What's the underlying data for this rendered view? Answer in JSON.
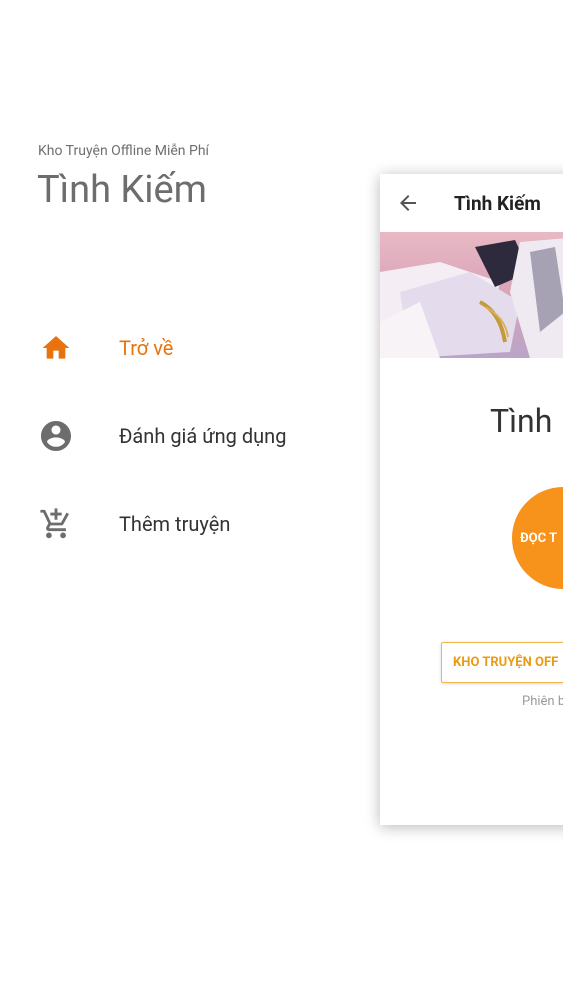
{
  "drawer": {
    "subtitle": "Kho Truyện Offline Miễn Phí",
    "title": "Tình Kiếm",
    "items": [
      {
        "label": "Trở về",
        "icon": "home-icon",
        "active": true
      },
      {
        "label": "Đánh giá ứng dụng",
        "icon": "account-circle-icon",
        "active": false
      },
      {
        "label": "Thêm truyện",
        "icon": "add-cart-icon",
        "active": false
      }
    ]
  },
  "preview": {
    "appbar_title": "Tình Kiếm",
    "heading": "Tình",
    "read_button": "ĐỌC T",
    "store_button": "KHO TRUYỆN OFF",
    "version": "Phiên b"
  },
  "colors": {
    "accent": "#e8730e",
    "orange": "#f7921a",
    "icon_gray": "#6d6d6d"
  }
}
